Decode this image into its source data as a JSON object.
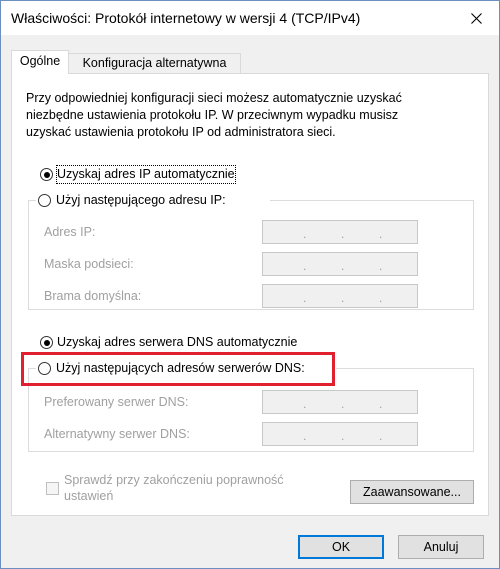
{
  "window": {
    "title": "Właściwości: Protokół internetowy w wersji 4 (TCP/IPv4)",
    "close_icon": "close-icon"
  },
  "tabs": [
    {
      "label": "Ogólne",
      "active": true
    },
    {
      "label": "Konfiguracja alternatywna",
      "active": false
    }
  ],
  "description": [
    "Przy odpowiedniej konfiguracji sieci możesz automatycznie uzyskać",
    "niezbędne ustawienia protokołu IP. W przeciwnym wypadku musisz",
    "uzyskać ustawienia protokołu IP od administratora sieci."
  ],
  "ip": {
    "auto_label": "Uzyskaj adres IP automatycznie",
    "manual_label": "Użyj następującego adresu IP:",
    "fields": [
      {
        "label": "Adres IP:"
      },
      {
        "label": "Maska podsieci:"
      },
      {
        "label": "Brama domyślna:"
      }
    ]
  },
  "dns": {
    "auto_label": "Uzyskaj adres serwera DNS automatycznie",
    "manual_label": "Użyj następujących adresów serwerów DNS:",
    "fields": [
      {
        "label": "Preferowany serwer DNS:"
      },
      {
        "label": "Alternatywny serwer DNS:"
      }
    ]
  },
  "validate": {
    "line1": "Sprawdź przy zakończeniu poprawność",
    "line2": "ustawień"
  },
  "advanced_button": "Zaawansowane...",
  "ok_button": "OK",
  "cancel_button": "Anuluj",
  "dot": ".",
  "colors": {
    "highlight": "#e0202e",
    "default_button_border": "#0078d7"
  }
}
